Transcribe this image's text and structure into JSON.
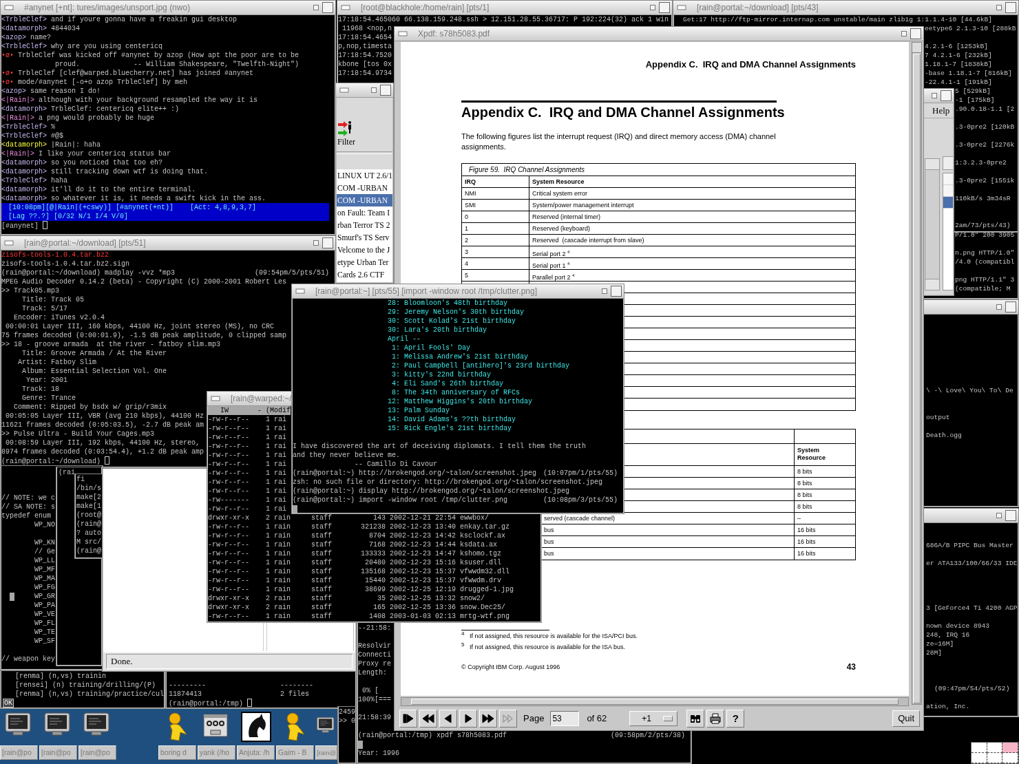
{
  "desktop": {
    "windows": [
      {
        "kind": "terminal",
        "title": "#anynet [+nt]: tures/images/unsport.jpg (nwo)",
        "lines": [
          {
            "kind": "chat",
            "nick": "<TrbleClef>",
            "text": "and if youre gonna have a freakin gui desktop"
          },
          {
            "kind": "chat",
            "nick": "<datamorph>",
            "text": "4844034"
          },
          {
            "kind": "chat",
            "nick": "<azop>",
            "text": "name?"
          },
          {
            "kind": "chat",
            "nick": "<TrbleClef>",
            "text": "why are you using centericq"
          },
          {
            "kind": "event",
            "nick": "•ø•",
            "text": "TrbleClef was kicked off #anynet by azop (How apt the poor are to be"
          },
          "             proud.             -- William Shakespeare, \"Twelfth-Night\")",
          {
            "kind": "event",
            "nick": "•ø•",
            "text": "TrbleClef [clef@warped.bluecherry.net] has joined #anynet"
          },
          {
            "kind": "event",
            "nick": "•ø•",
            "text": "mode/#anynet [-o+o azop TrbleClef] by meh"
          },
          {
            "kind": "chat",
            "nick": "<azop>",
            "text": "same reason I do!"
          },
          {
            "kind": "own",
            "nick": "<|Rain|>",
            "text": "although with your background resampled the way it is"
          },
          {
            "kind": "chat",
            "nick": "<datamorph>",
            "text": "TrbleClef: centericq elite++ :)"
          },
          {
            "kind": "own",
            "nick": "<|Rain|>",
            "text": "a png would probably be huge"
          },
          {
            "kind": "chat",
            "nick": "<TrbleClef>",
            "text": "%"
          },
          {
            "kind": "chat",
            "nick": "<TrbleClef>",
            "text": "#@$"
          },
          {
            "kind": "mention",
            "nick": "<datamorph>",
            "text": "|Rain|: haha"
          },
          {
            "kind": "own",
            "nick": "<|Rain|>",
            "text": "I like your centericq status bar"
          },
          {
            "kind": "chat",
            "nick": "<datamorph>",
            "text": "so you noticed that too eh?"
          },
          {
            "kind": "chat",
            "nick": "<datamorph>",
            "text": "still tracking down wtf is doing that."
          },
          {
            "kind": "chat",
            "nick": "<TrbleClef>",
            "text": "haha"
          },
          {
            "kind": "chat",
            "nick": "<datamorph>",
            "text": "it'll do it to the entire terminal."
          },
          {
            "kind": "chat",
            "nick": "<datamorph>",
            "text": "so whatever it is, it needs a swift kick in the ass."
          },
          {
            "kind": "status",
            "text": "[10:08pm][@|Rain|(+cswy)] [#anynet(+nt)]    [Act: 4,8,9,3,7]"
          },
          {
            "kind": "status",
            "text": "[Lag ??.?] [0/32 N/1 I/4 V/0]"
          },
          {
            "kind": "prompt",
            "text": "[#anynet]"
          }
        ]
      },
      {
        "kind": "terminal",
        "title": "[root@blackhole:/home/rain] [pts/1]",
        "lines": [
          "17:18:54.465060 66.138.159.248.ssh > 12.151.28.55.36717: P 192:224(32) ack 1 win",
          " 11968 <nop,n",
          "17:18:54.4654",
          "p,nop,timesta",
          "17:18:54.7520",
          "kbone [tos 0x",
          "17:18:54.9734"
        ]
      },
      {
        "kind": "terminal",
        "title": "[rain@portal:~/download] [pts/43]",
        "lines": [
          "Get:17 http://ftp-mirror.internap.com unstable/main zlib1g 1:1.1.4-10 [44.6kB]",
          "eetype6 2.1.3-10 [288kB",
          "4.2.1-6 [1253kB]",
          "7 4.2.1-6 [232kB]",
          "1.18.1-7 [1838kB]",
          "-base 1.18.1-7 [816kB]",
          "-22.4.1-1 [191kB]",
          "5 [529kB]",
          "-1 [175kB]",
          ".90.0.18-1.1 [2",
          ".3-0pre2 [120kB",
          ".3-0pre2 [2276k",
          "1:3.2.3-0pre2",
          ".3-0pre2 [1551k",
          "110kB/s 3m34sR",
          "2am/73/pts/43)"
        ]
      },
      {
        "kind": "server-browser",
        "filter": "Filter",
        "servers": [
          {
            "name": "LINUX UT 2.6/1",
            "selected": false
          },
          {
            "name": "COM -URBAN",
            "selected": false
          },
          {
            "name": "COM -URBAN",
            "selected": true
          },
          {
            "name": "on Fault: Team I",
            "selected": false
          },
          {
            "name": "rban Terror TS 2",
            "selected": false
          },
          {
            "name": "Smurf's TS Serv",
            "selected": false
          },
          {
            "name": "Velcome to the J",
            "selected": false
          },
          {
            "name": "etype Urban Ter",
            "selected": false
          },
          {
            "name": "Cards 2.6 CTF",
            "selected": false
          }
        ]
      },
      {
        "kind": "pdf-viewer",
        "title": "Xpdf: s78h5083.pdf",
        "page": {
          "running_head": "Appendix C.  IRQ and DMA Channel Assignments",
          "heading": "Appendix C.  IRQ and DMA Channel Assignments",
          "intro": "The following figures list the interrupt request (IRQ) and direct memory access (DMA) channel assignments.",
          "irq_table": {
            "caption": "Figure 59.  IRQ Channel Assignments",
            "columns": [
              "IRQ",
              "System Resource"
            ],
            "rows": [
              [
                "NMI",
                "Critical system error"
              ],
              [
                "SMI",
                "System/power management interrupt"
              ],
              [
                "0",
                "Reserved (internal timer)"
              ],
              [
                "1",
                "Reserved (keyboard)"
              ],
              [
                "2",
                "Reserved  (cascade interrupt from slave)"
              ],
              [
                "3",
                "Serial port 2 $^{4}$"
              ],
              [
                "4",
                "Serial port 1 $^{4}$"
              ],
              [
                "5",
                "Parallel port 2 $^{4}$"
              ]
            ]
          },
          "dma_table": {
            "column_3": "System Resource",
            "rows": [
              {
                "column_3": "8 bits"
              },
              {
                "column_3": "8 bits"
              },
              {
                "column_3": "8 bits"
              },
              {
                "column_3": "8 bits"
              },
              {
                "column_2": "served (cascade channel)",
                "column_3": "–"
              },
              {
                "column_2": "bus",
                "column_3": "16 bits"
              },
              {
                "column_2": "bus",
                "column_3": "16 bits"
              },
              {
                "column_2": "bus",
                "column_3": "16 bits"
              }
            ]
          },
          "footnotes": [
            {
              "mark": "4",
              "text": "If not assigned, this resource is available for the ISA/PCI bus."
            },
            {
              "mark": "5",
              "text": "If not assigned, this resource is available for the ISA bus."
            }
          ],
          "copyright": "© Copyright IBM Corp. August 1996",
          "page_number": "43"
        },
        "toolbar": {
          "nav_buttons": [
            {
              "disabled": false
            },
            {
              "disabled": false
            },
            {
              "disabled": false
            },
            {
              "disabled": false
            },
            {
              "disabled": false
            },
            {
              "disabled": true
            }
          ],
          "page_label": "Page",
          "page_field": "53",
          "page_count": "of 62",
          "zoom": "+1",
          "help": "?",
          "quit": "Quit"
        }
      },
      {
        "kind": "dialog",
        "menu": "Help",
        "rows": [
          {
            "selected": false
          },
          {
            "selected": false
          },
          {
            "selected": true
          }
        ]
      },
      {
        "kind": "terminal",
        "lines": [
          "P/1.0\" 200 3905",
          "n.png HTTP/1.0\"",
          "/4.0 (compatibl",
          "png HTTP/1.1\" 3",
          "(compatible; M"
        ]
      },
      {
        "kind": "terminal",
        "title": "[rain@portal:~/download] [pts/51]",
        "lines": [
          {
            "kind": "alert",
            "text": "zisofs-tools-1.0.4.tar.bz2"
          },
          "zisofs-tools-1.0.4.tar.bz2.sign",
          {
            "text": "(rain@portal:~/download) madplay -vvz *mp3",
            "right": "(09:54pm/5/pts/51)"
          },
          "MPEG Audio Decoder 0.14.2 (beta) - Copyright (C) 2000-2001 Robert Les",
          ">> Track05.mp3",
          "     Title: Track 05",
          "     Track: 5/17",
          "   Encoder: iTunes v2.0.4",
          " 00:00:01 Layer III, 160 kbps, 44100 Hz, joint stereo (MS), no CRC",
          "75 frames decoded (0:00:01.9), -1.5 dB peak amplitude, 0 clipped samp",
          ">> 18 - groove armada  at the river - fatboy slim.mp3",
          "     Title: Groove Armada / At the River",
          "    Artist: Fatboy Slim",
          "     Album: Essential Selection Vol. One",
          "      Year: 2001",
          "     Track: 18",
          "     Genre: Trance",
          "   Comment: Ripped by bsdx w/ grip/r3mix",
          " 00:05:05 Layer III, VBR (avg 210 kbps), 44100 Hz",
          "11621 frames decoded (0:05:03.5), -2.7 dB peak am",
          ">> Pulse Ultra - Build Your Cages.mp3",
          " 00:08:59 Layer III, 192 kbps, 44100 Hz, stereo,",
          "8974 frames decoded (0:03:54.4), +1.2 dB peak amp",
          {
            "kind": "prompt",
            "text": "(rain@portal:~/download)"
          }
        ]
      },
      {
        "kind": "terminal",
        "title": "[rain@portal:~] [pts/55] [import -window root /tmp/clutter.png]",
        "lines": [
          {
            "kind": "highlight",
            "text": "28: Bloomloon's 48th birthday"
          },
          {
            "kind": "highlight",
            "text": "29: Jeremy Nelson's 30th birthday"
          },
          {
            "kind": "highlight",
            "text": "30: Scott Kolad's 21st birthday"
          },
          {
            "kind": "highlight",
            "text": "30: Lara's 20th birthday"
          },
          {
            "kind": "highlight",
            "text": "April --"
          },
          {
            "kind": "highlight",
            "text": " 1: April Fools' Day"
          },
          {
            "kind": "highlight",
            "text": " 1: Melissa Andrew's 21st birthday"
          },
          {
            "kind": "highlight",
            "text": " 2: Paul Campbell [antihero]'s 23rd birthday"
          },
          {
            "kind": "highlight",
            "text": " 3: kitty's 22nd birthday"
          },
          {
            "kind": "highlight",
            "text": " 4: Eli Sand's 26th birthday"
          },
          {
            "kind": "highlight",
            "text": " 8: The 34th anniversary of RFCs"
          },
          {
            "kind": "highlight",
            "text": "12: Matthew Higgins's 20th birthday"
          },
          {
            "kind": "highlight",
            "text": "13: Palm Sunday"
          },
          {
            "kind": "highlight",
            "text": "14: David Adams's ??th birthday"
          },
          {
            "kind": "highlight",
            "text": "15: Rick Engle's 21st birthday"
          },
          "I have discovered the art of deceiving diplomats. I tell them the truth",
          "and they never believe me.",
          "-- Camillo Di Cavour",
          {
            "text": "(rain@portal:~) http://brokengod.org/~talon/screenshot.jpeg",
            "right": "(10:07pm/1/pts/55)"
          },
          "zsh: no such file or directory: http://brokengod.org/~talon/screenshot.jpeg",
          "(rain@portal:~) display http://brokengod.org/~talon/screenshot.jpeg",
          {
            "text": "(rain@portal:~) import -window root /tmp/clutter.png",
            "right": "(10:08pm/3/pts/55)"
          },
          {
            "kind": "cursor"
          }
        ]
      },
      {
        "kind": "terminal",
        "lines": [
          "\\ -\\ Love\\ You\\ To\\ De",
          "output",
          "Death.ogg"
        ]
      },
      {
        "kind": "terminal",
        "title": "[rain@warped:~/",
        "lines": [
          {
            "kind": "header",
            "text": "   IW       - (Modif"
          },
          "-rw-r--r--    1 rai",
          "-rw-r--r--    1 rai",
          "-rw-r--r--    1 rai",
          "-rw-r--r--    1 rai",
          "-rw-r--r--    1 rai",
          "-rw-r--r--    1 rai",
          "-rw-r--r--    1 rai",
          "-rw-r--r--    1 rai",
          "-rw-r--r--    1 rai",
          "-rw-------    1 rai",
          "-rw-r--r--    1 rai",
          "drwxr-xr-x    2 rain     staff          143 2002-12-21 22:54 ewwbox/",
          "-rw-r--r--    1 rain     staff       321238 2002-12-23 13:40 enkay.tar.gz",
          "-rw-r--r--    1 rain     staff         8704 2002-12-23 14:42 ksclockf.ax",
          "-rw-r--r--    1 rain     staff         7168 2002-12-23 14:44 ksdata.ax",
          "-rw-r--r--    1 rain     staff       133333 2002-12-23 14:47 kshomo.tgz",
          "-rw-r--r--    1 rain     staff        20480 2002-12-23 15:16 ksuser.dll",
          "-rw-r--r--    1 rain     staff       135168 2002-12-23 15:37 vfwwdm32.dll",
          "-rw-r--r--    1 rain     staff        15440 2002-12-23 15:37 vfwwdm.drv",
          "-rw-r--r--    1 rain     staff        38699 2002-12-25 12:19 drugged-1.jpg",
          "drwxr-xr-x    2 rain     staff           35 2002-12-25 13:32 snow2/",
          "drwxr-xr-x    2 rain     staff          165 2002-12-25 13:36 snow.Dec25/",
          "-rw-r--r--    1 rain     staff         1408 2003-01-03 02:13 mrtg-wtf.png"
        ]
      },
      {
        "kind": "terminal",
        "lines": [
          "686A/B PIPC Bus Master",
          "er ATA133/100/66/33 IDE",
          "3 [GeForce4 Ti 4200 AGP",
          "nown device 8943",
          "248, IRQ 16",
          "ze=16M]",
          "28M]",
          "(09:47pm/54/pts/52)",
          "ation, Inc."
        ]
      },
      {
        "kind": "terminal",
        "lines": [
          "// NOTE: we c",
          "// SA NOTE: s",
          "typedef enum",
          "WP_NO",
          "WP_KN",
          "// Ge",
          "WP_LL",
          "WP_MF",
          "WP_MA",
          "WP_FG",
          {
            "kind": "cursor"
          },
          "WP_GR",
          "WP_PA",
          "WP_VE",
          "WP_FL",
          "WP_TE",
          "WP_SF",
          "// weapon key"
        ]
      },
      {
        "kind": "terminal",
        "lines": [
          "(rai"
        ]
      },
      {
        "kind": "terminal",
        "lines": [
          "fi",
          "/bin/s",
          "make[2",
          "make[1",
          "(root@",
          "(rain@",
          "? auto",
          "M src/",
          "(rain@"
        ]
      },
      {
        "kind": "web-browser",
        "status": "Done."
      },
      {
        "kind": "terminal",
        "lines": [
          "[renma] (n,vs) trainin",
          "[rensei] (n) training/drilling/(P)",
          "[renma] (n,vs) training/practice/cul",
          {
            "kind": "boxed",
            "text": "OK"
          }
        ]
      },
      {
        "kind": "terminal",
        "lines": [
          "---------                  --------",
          "11874413                   2 files",
          {
            "kind": "prompt",
            "text": "(rain@portal:/tmp)"
          }
        ]
      },
      {
        "kind": "terminal",
        "lines": [
          "2459",
          ">> 0"
        ]
      },
      {
        "kind": "terminal",
        "lines": [
          "--21:58:",
          "Resolvir",
          "Connecti",
          "Proxy re",
          "Length:",
          " 0% [",
          "100%[===",
          "21:58:39",
          {
            "text": "(rain@portal:/tmp) xpdf s78h5083.pdf",
            "right": "(09:58pm/2/pts/38)"
          },
          {
            "kind": "cursor"
          },
          "Year: 1996"
        ]
      }
    ],
    "taskbar": {
      "items": [
        {
          "kind": "terminal",
          "label": "[rain@po"
        },
        {
          "kind": "terminal",
          "label": "[rain@po"
        },
        {
          "kind": "terminal",
          "label": "[rain@po"
        },
        {
          "kind": "chat",
          "label": "boring d"
        },
        {
          "kind": "dialog",
          "label": "yank (/ho"
        },
        {
          "kind": "ide",
          "label": "Anjuta: /h"
        },
        {
          "kind": "chat",
          "label": "Gaim - B"
        },
        {
          "kind": "terminal",
          "label": "[rain@"
        }
      ]
    },
    "pager": [
      {
        "selected": false
      },
      {
        "selected": false
      },
      {
        "selected": true
      },
      {
        "selected": false
      },
      {
        "selected": false
      },
      {
        "selected": false
      }
    ]
  }
}
